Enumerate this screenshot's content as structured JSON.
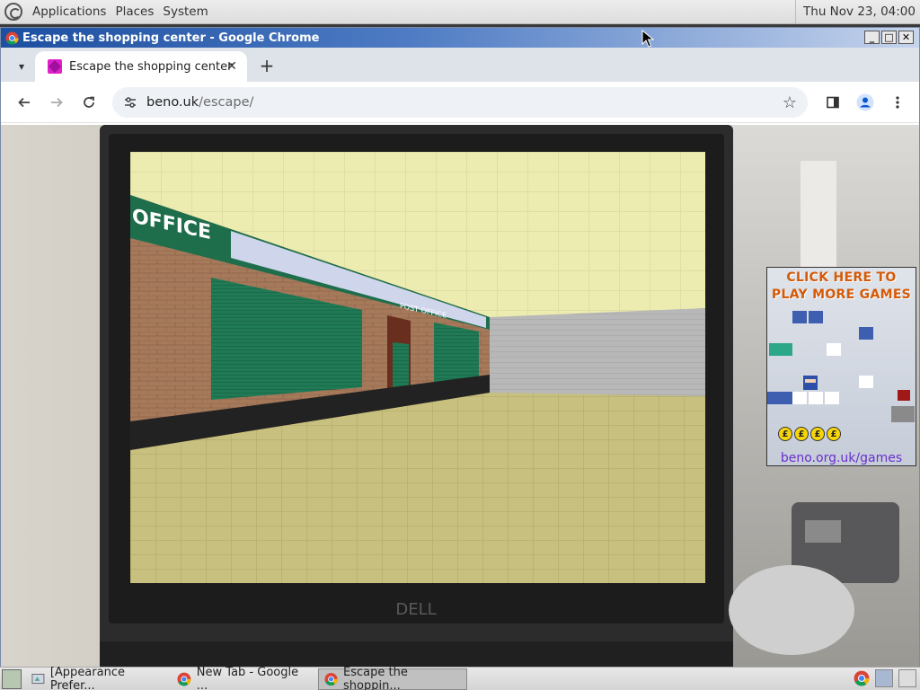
{
  "top_panel": {
    "menus": [
      "Applications",
      "Places",
      "System"
    ],
    "clock": "Thu Nov 23, 04:00"
  },
  "window": {
    "title": "Escape the shopping center - Google Chrome"
  },
  "tabs": [
    {
      "label": "Escape the shopping center",
      "active": true
    }
  ],
  "address_bar": {
    "host": "beno.uk",
    "path": "/escape/"
  },
  "promo": {
    "line1": "CLICK HERE TO",
    "line2": "PLAY MORE GAMES",
    "coin_symbol": "£",
    "link": "beno.org.uk/games"
  },
  "game_scene": {
    "sign_main": "OFFICE",
    "sign_post": "POST OFFICE"
  },
  "taskbar": {
    "items": [
      {
        "label": "[Appearance Prefer...",
        "icon": "appearance-icon",
        "active": false
      },
      {
        "label": "New Tab - Google ...",
        "icon": "chrome-icon",
        "active": false
      },
      {
        "label": "Escape the shoppin...",
        "icon": "chrome-icon",
        "active": true
      }
    ]
  },
  "colors": {
    "titlebar": "#1c4fa0",
    "shutter_green": "#1f7a55",
    "ceiling": "#ecebb0",
    "promo_title": "#d45a08",
    "promo_link": "#6a2fd0"
  }
}
